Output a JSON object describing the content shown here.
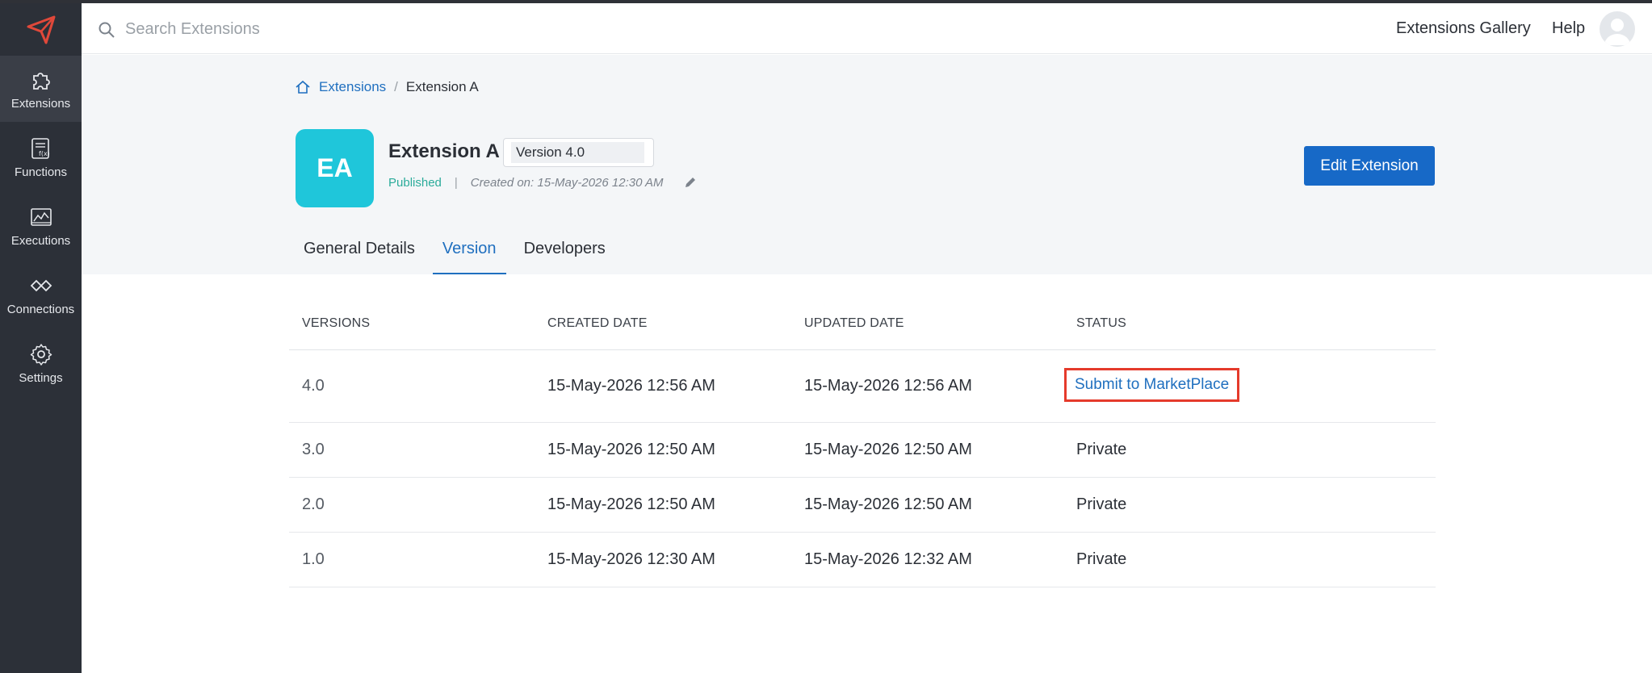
{
  "sidebar": {
    "items": [
      {
        "label": "Extensions",
        "icon": "puzzle-icon",
        "active": true
      },
      {
        "label": "Functions",
        "icon": "function-icon",
        "active": false
      },
      {
        "label": "Executions",
        "icon": "chart-icon",
        "active": false
      },
      {
        "label": "Connections",
        "icon": "connections-icon",
        "active": false
      },
      {
        "label": "Settings",
        "icon": "gear-icon",
        "active": false
      }
    ]
  },
  "topbar": {
    "search_placeholder": "Search Extensions",
    "gallery_label": "Extensions Gallery",
    "help_label": "Help"
  },
  "breadcrumb": {
    "root": "Extensions",
    "current": "Extension A"
  },
  "extension": {
    "initials": "EA",
    "name": "Extension A",
    "version": "Version 4.0",
    "status": "Published",
    "created": "Created on: 15-May-2026 12:30 AM",
    "edit_label": "Edit Extension",
    "avatar_color": "#1fc6da"
  },
  "tabs": [
    {
      "label": "General Details",
      "active": false
    },
    {
      "label": "Version",
      "active": true
    },
    {
      "label": "Developers",
      "active": false
    }
  ],
  "table": {
    "headers": [
      "VERSIONS",
      "CREATED DATE",
      "UPDATED DATE",
      "STATUS"
    ],
    "rows": [
      {
        "version": "4.0",
        "created": "15-May-2026 12:56 AM",
        "updated": "15-May-2026 12:56 AM",
        "status": "Submit to MarketPlace"
      },
      {
        "version": "3.0",
        "created": "15-May-2026 12:50 AM",
        "updated": "15-May-2026 12:50 AM",
        "status": "Private"
      },
      {
        "version": "2.0",
        "created": "15-May-2026 12:50 AM",
        "updated": "15-May-2026 12:50 AM",
        "status": "Private"
      },
      {
        "version": "1.0",
        "created": "15-May-2026 12:30 AM",
        "updated": "15-May-2026 12:32 AM",
        "status": "Private"
      }
    ]
  },
  "colors": {
    "accent": "#1769c7",
    "sidebar_bg": "#2c3038",
    "highlight_border": "#e53a2b"
  }
}
